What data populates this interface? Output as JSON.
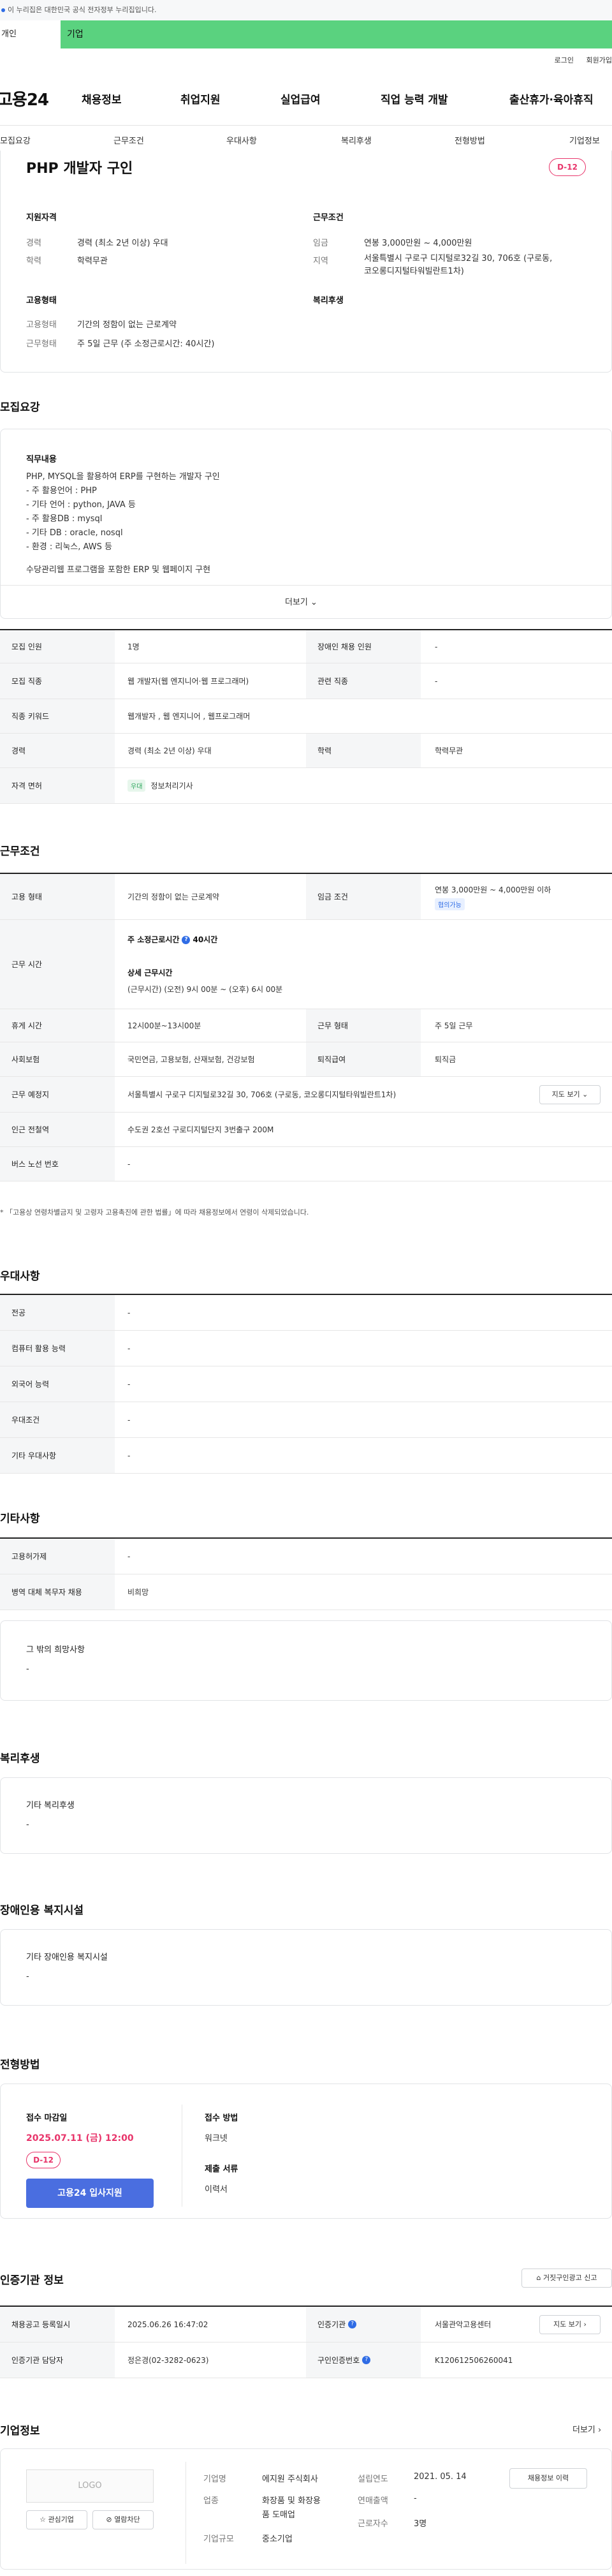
{
  "gov_notice": "이 누리집은 대한민국 공식 전자정부 누리집입니다.",
  "top_tabs": {
    "personal": "개인",
    "company": "기업"
  },
  "util": {
    "login": "로그인",
    "join": "회원가입"
  },
  "gnb": {
    "logo": "고용24",
    "items": [
      "채용정보",
      "취업지원",
      "실업급여",
      "직업 능력 개발",
      "출산휴가·육아휴직"
    ]
  },
  "subnav": [
    "모집요강",
    "근무조건",
    "우대사항",
    "복리후생",
    "전형방법",
    "기업정보"
  ],
  "job": {
    "title": "PHP 개발자 구인",
    "dday": "D-12",
    "qual_title": "지원자격",
    "qual": [
      {
        "k": "경력",
        "v": "경력 (최소 2년 이상) 우대"
      },
      {
        "k": "학력",
        "v": "학력무관"
      }
    ],
    "cond_title": "근무조건",
    "cond": [
      {
        "k": "임금",
        "v": "연봉 3,000만원 ~ 4,000만원"
      },
      {
        "k": "지역",
        "v": "서울특별시 구로구 디지털로32길 30, 706호 (구로동,",
        "v2": "코오롱디지털타워빌란트1차)"
      }
    ],
    "emp_title": "고용형태",
    "emp": [
      {
        "k": "고용형태",
        "v": "기간의 정함이 없는 근로계약"
      },
      {
        "k": "근무형태",
        "v": "주 5일 근무 (주 소정근로시간: 40시간)"
      }
    ],
    "welfare_title": "복리후생"
  },
  "recruit": {
    "section": "모집요강",
    "duty_title": "직무내용",
    "duty_lines": [
      "PHP, MYSQL을 활용하여 ERP를 구현하는 개발자 구인",
      "- 주 활용언어 : PHP",
      "- 기타 언어 : python, JAVA 등",
      "- 주 활용DB : mysql",
      "- 기타 DB : oracle, nosql",
      "- 환경 : 리눅스, AWS 등",
      "",
      "수당관리웹 프로그램을 포함한 ERP 및 웹페이지 구현"
    ],
    "more": "더보기",
    "rows": [
      {
        "k": "모집 인원",
        "v": "1명",
        "k2": "장애인 채용 인원",
        "v2": "-"
      },
      {
        "k": "모집 직종",
        "v": "웹 개발자(웹 엔지니어·웹 프로그래머)",
        "k2": "관련 직종",
        "v2": "-"
      },
      {
        "k": "직종 키워드",
        "v": "웹개발자 , 웹 엔지니어 , 웹프로그래머",
        "k2": "",
        "v2": ""
      },
      {
        "k": "경력",
        "v": "경력 (최소 2년 이상) 우대",
        "k2": "학력",
        "v2": "학력무관"
      },
      {
        "k": "자격 면허",
        "badge": "우대",
        "v": "정보처리기사",
        "k2": "",
        "v2": ""
      }
    ]
  },
  "work": {
    "section": "근무조건",
    "emp_type_k": "고용 형태",
    "emp_type_v": "기간의 정함이 없는 근로계약",
    "wage_k": "임금 조건",
    "wage_v": "연봉 3,000만원 ~ 4,000만원 이하",
    "wage_badge": "협의가능",
    "time_k": "근무 시간",
    "time_main": "주 소정근로시간",
    "time_hours": "40시간",
    "time_detail_title": "상세 근무시간",
    "time_detail": "(근무시간) (오전) 9시 00분 ~ (오후) 6시 00분",
    "rows": [
      {
        "k": "휴게 시간",
        "v": "12시00분~13시00분",
        "k2": "근무 형태",
        "v2": "주 5일 근무"
      },
      {
        "k": "사회보험",
        "v": "국민연금, 고용보험, 산재보험, 건강보험",
        "k2": "퇴직급여",
        "v2": "퇴직금"
      }
    ],
    "place_k": "근무 예정지",
    "place_v": "서울특별시 구로구 디지털로32길 30, 706호 (구로동, 코오롱디지털타워빌란트1차)",
    "map_btn": "지도 보기",
    "subway_k": "인근 전철역",
    "subway_v": "수도권 2호선 구로디지털단지 3번출구 200M",
    "bus_k": "버스 노선 번호",
    "bus_v": "-",
    "note": "* 「고용상 연령차별금지 및 고령자 고용촉진에 관한 법률」에 따라 채용정보에서 연령이 삭제되었습니다."
  },
  "pref": {
    "section": "우대사항",
    "rows": [
      {
        "k": "전공",
        "v": "-"
      },
      {
        "k": "컴퓨터 활용 능력",
        "v": "-"
      },
      {
        "k": "외국어 능력",
        "v": "-"
      },
      {
        "k": "우대조건",
        "v": "-"
      },
      {
        "k": "기타 우대사항",
        "v": "-"
      }
    ]
  },
  "etc": {
    "section": "기타사항",
    "rows": [
      {
        "k": "고용허가제",
        "v": "-"
      },
      {
        "k": "병역 대체 복무자 채용",
        "v": "비희망"
      }
    ],
    "other_title": "그 밖의 희망사항",
    "other_v": "-"
  },
  "welfare": {
    "section": "복리후생",
    "title": "기타 복리후생",
    "v": "-"
  },
  "disab": {
    "section": "장애인용 복지시설",
    "title": "기타 장애인용 복지시설",
    "v": "-"
  },
  "process": {
    "section": "전형방법",
    "deadline_title": "접수 마감일",
    "deadline": "2025.07.11 (금) 12:00",
    "dday": "D-12",
    "apply_btn": "고용24 입사지원",
    "method_title": "접수 방법",
    "method": "워크넷",
    "docs_title": "제출 서류",
    "docs": "이력서"
  },
  "agency": {
    "section": "인증기관 정보",
    "report_btn": "거짓구인광고 신고",
    "reg_k": "채용공고 등록일시",
    "reg_v": "2025.06.26 16:47:02",
    "org_k": "인증기관",
    "org_v": "서울관악고용센터",
    "map_btn": "지도 보기",
    "mgr_k": "인증기관 담당자",
    "mgr_v": "정은경(02-3282-0623)",
    "no_k": "구인인증번호",
    "no_v": "K120612506260041"
  },
  "company": {
    "section": "기업정보",
    "more": "더보기",
    "logo": "LOGO",
    "fav_btn": "관심기업",
    "block_btn": "열람차단",
    "name_k": "기업명",
    "name_v": "에지원 주식회사",
    "ind_k": "업종",
    "ind_v": "화장품 및 화장용",
    "ind_v2": "품 도매업",
    "size_k": "기업규모",
    "size_v": "중소기업",
    "est_k": "설립연도",
    "est_v": "2021. 05. 14",
    "sales_k": "연매출액",
    "sales_v": "-",
    "emp_k": "근로자수",
    "emp_v": "3명",
    "recruit_btn": "채용정보 이력"
  }
}
